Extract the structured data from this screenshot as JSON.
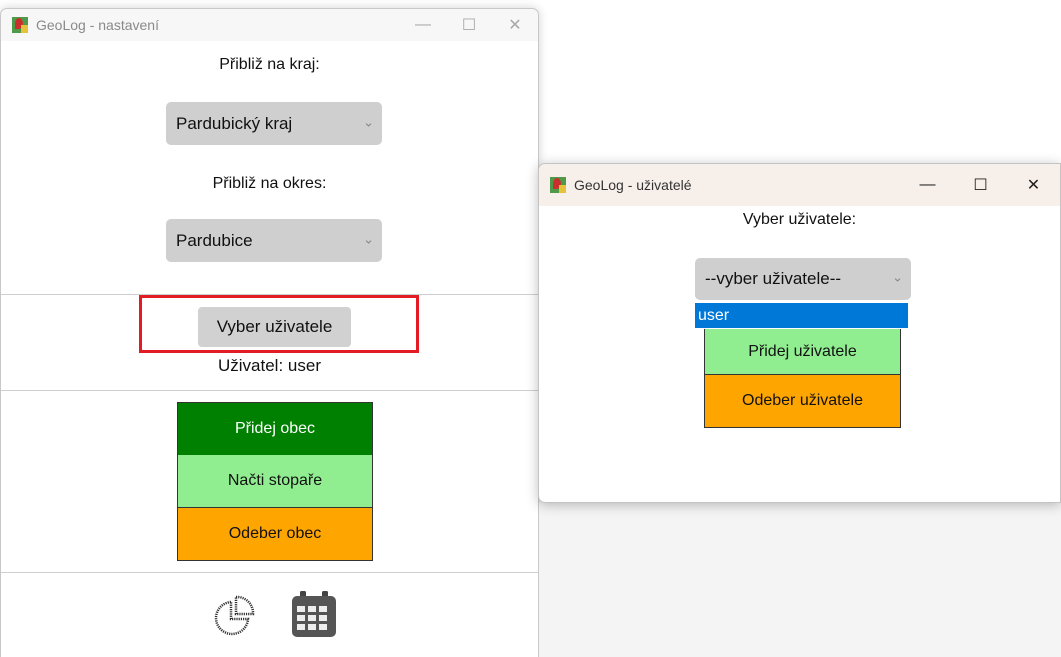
{
  "settings_window": {
    "title": "GeoLog - nastavení",
    "region_label": "Přibliž na kraj:",
    "region_value": "Pardubický kraj",
    "district_label": "Přibliž na okres:",
    "district_value": "Pardubice",
    "select_user_button": "Vyber uživatele",
    "user_label": "Uživatel:  user",
    "add_town_button": "Přidej obec",
    "load_hitchhikers_button": "Načti stopaře",
    "remove_town_button": "Odeber obec",
    "icons": [
      "pie-chart-icon",
      "calendar-icon"
    ]
  },
  "users_window": {
    "title": "GeoLog - uživatelé",
    "select_label": "Vyber uživatele:",
    "select_value": "--vyber uživatele--",
    "dropdown_option": "user",
    "add_user_button": "Přidej uživatele",
    "remove_user_button": "Odeber uživatele"
  },
  "colors": {
    "dark_green": "#008000",
    "light_green": "#90ee90",
    "orange": "#ffa500",
    "highlight_red": "#e21b25",
    "selection_blue": "#0078d7"
  }
}
